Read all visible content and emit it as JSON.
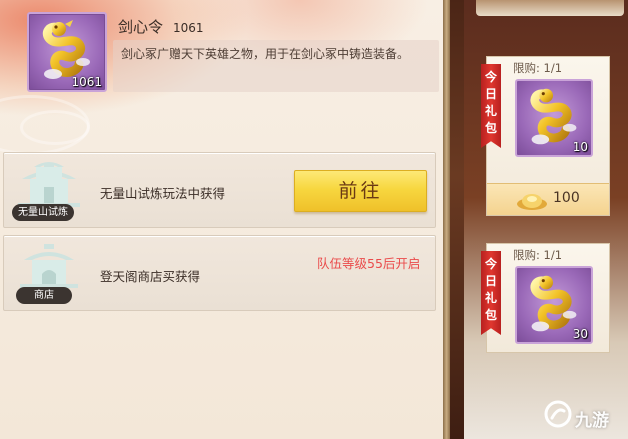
{
  "item": {
    "title": "剑心令",
    "count_header": "1061",
    "count_badge": "1061",
    "description": "剑心冢广赠天下英雄之物，用于在剑心冢中铸造装备。",
    "icon": "golden-dragon-icon"
  },
  "sources": [
    {
      "tag": "无量山试炼",
      "text": "无量山试炼玩法中获得",
      "button_label": "前往"
    },
    {
      "tag": "商店",
      "text": "登天阁商店买获得",
      "locked_label": "队伍等级55后开启"
    }
  ],
  "gift_packs": [
    {
      "limit": "限购: 1/1",
      "ribbon": "今日礼包",
      "item_count": "10",
      "price": "100",
      "currency_icon": "gold-ingot-icon"
    },
    {
      "limit": "限购: 1/1",
      "ribbon": "今日礼包",
      "item_count": "30"
    }
  ],
  "watermark": {
    "text": "九游",
    "icon": "jiuyou-logo-icon"
  },
  "colors": {
    "accent_red": "#ea4b4b",
    "button_gold": "#f7d73f",
    "item_purple": "#9a69b8"
  }
}
